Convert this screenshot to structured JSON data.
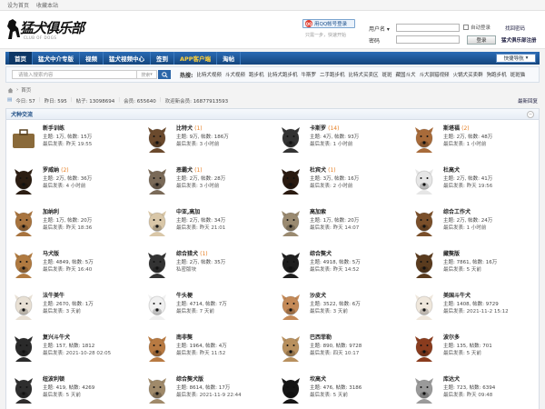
{
  "topbar": {
    "set_home": "设为首页",
    "bookmark": "收藏本站"
  },
  "logo": {
    "brand": "猛犬俱乐部",
    "sub": "CLUB OF DOGS"
  },
  "login": {
    "qq_label": "用QQ帐号登录",
    "qq_tip": "只需一步，快速开始",
    "username_label": "用户名",
    "password_label": "密码",
    "auto_login": "自动登录",
    "login_button": "登录",
    "forgot": "找回密码",
    "register": "猛犬俱乐部注册"
  },
  "nav": {
    "items": [
      "首页",
      "猛犬中介专版",
      "视频",
      "猛犬视频中心",
      "签到",
      "APP客户端",
      "淘帖"
    ],
    "quick_nav": "快捷导航"
  },
  "search": {
    "placeholder": "请输入搜索内容",
    "type": "搜索",
    "hot_label": "热搜:",
    "hot_links": [
      "比特犬视频",
      "斗犬视频",
      "跑步机",
      "比特犬跑步机",
      "牛斯罗",
      "二手跑步机",
      "比特犬买卖区",
      "斑斑",
      "藏国斗犬",
      "斗犬驯猎视频",
      "火锅犬买卖群",
      "狗跑步机",
      "斑斑猫"
    ]
  },
  "breadcrumb": {
    "home": "首页"
  },
  "stats": {
    "today_label": "今日:",
    "today": "57",
    "yesterday_label": "昨日:",
    "yesterday": "595",
    "posts_label": "帖子:",
    "posts": "13098694",
    "members_label": "会员:",
    "members": "655640",
    "newest_label": "欢迎新会员:",
    "newest": "16877913593",
    "latest_reply": "最新回复"
  },
  "forum": {
    "title": "犬种交流",
    "collapse": "−",
    "boards": [
      {
        "name": "新手训练",
        "new": "",
        "meta": "主题: 1万, 帖数: 15万",
        "last": "最后发表: 昨天 19:55",
        "icon": "briefcase-icon",
        "color": "#8a6a3a"
      },
      {
        "name": "比特犬",
        "new": "(1)",
        "meta": "主题: 9万, 帖数: 186万",
        "last": "最后发表: 3 小时前",
        "icon": "pitbull-icon",
        "color": "#6b4a2d"
      },
      {
        "name": "卡斯罗",
        "new": "(14)",
        "meta": "主题: 4万, 帖数: 93万",
        "last": "最后发表: 1 小时前",
        "icon": "cane-corso-icon",
        "color": "#333"
      },
      {
        "name": "斯塔福",
        "new": "(2)",
        "meta": "主题: 2万, 帖数: 48万",
        "last": "最后发表: 1 小时前",
        "icon": "staffy-icon",
        "color": "#a86b3a"
      },
      {
        "name": "罗威纳",
        "new": "(2)",
        "meta": "主题: 2万, 帖数: 36万",
        "last": "最后发表: 4 小时前",
        "icon": "rottweiler-icon",
        "color": "#2b1d12"
      },
      {
        "name": "恶霸犬",
        "new": "(1)",
        "meta": "主题: 2万, 帖数: 28万",
        "last": "最后发表: 3 小时前",
        "icon": "bully-icon",
        "color": "#7a6a58"
      },
      {
        "name": "杜宾犬",
        "new": "(1)",
        "meta": "主题: 3万, 帖数: 16万",
        "last": "最后发表: 2 小时前",
        "icon": "doberman-icon",
        "color": "#2a1a10"
      },
      {
        "name": "杜高犬",
        "new": "",
        "meta": "主题: 2万, 帖数: 41万",
        "last": "最后发表: 昨天 19:56",
        "icon": "dogo-icon",
        "color": "#e6e6e6"
      },
      {
        "name": "加纳利",
        "new": "",
        "meta": "主题: 1万, 帖数: 20万",
        "last": "最后发表: 昨天 18:36",
        "icon": "presa-icon",
        "color": "#a8743f"
      },
      {
        "name": "中亚,高加",
        "new": "",
        "meta": "主题: 2万, 帖数: 34万",
        "last": "最后发表: 昨天 21:01",
        "icon": "caucasian-icon",
        "color": "#d9c7a8"
      },
      {
        "name": "高加索",
        "new": "",
        "meta": "主题: 1万, 帖数: 20万",
        "last": "最后发表: 昨天 14:07",
        "icon": "kangal-icon",
        "color": "#9a8a70"
      },
      {
        "name": "综合工作犬",
        "new": "",
        "meta": "主题: 2万, 帖数: 24万",
        "last": "最后发表: 1 小时前",
        "icon": "shepherd-icon",
        "color": "#7a4f2a"
      },
      {
        "name": "马犬版",
        "new": "",
        "meta": "主题: 4849, 帖数: 5万",
        "last": "最后发表: 昨天 16:40",
        "icon": "malinois-icon",
        "color": "#b07a40"
      },
      {
        "name": "综合猎犬",
        "new": "(1)",
        "meta": "主题: 2万, 帖数: 35万",
        "last": "私密版块",
        "icon": "hound-icon",
        "color": "#333"
      },
      {
        "name": "综合獒犬",
        "new": "",
        "meta": "主题: 4918, 帖数: 5万",
        "last": "最后发表: 昨天 14:52",
        "icon": "mastiff-icon",
        "color": "#1e1e1e"
      },
      {
        "name": "藏獒版",
        "new": "",
        "meta": "主题: 7861, 帖数: 16万",
        "last": "最后发表: 5 天前",
        "icon": "tibetan-icon",
        "color": "#5a3b1e"
      },
      {
        "name": "法牛美牛",
        "new": "",
        "meta": "主题: 2670, 帖数: 1万",
        "last": "最后发表: 3 天前",
        "icon": "frenchie-icon",
        "color": "#e8e0d4"
      },
      {
        "name": "牛头梗",
        "new": "",
        "meta": "主题: 4714, 帖数: 7万",
        "last": "最后发表: 7 天前",
        "icon": "bull-terrier-icon",
        "color": "#f0f0f0"
      },
      {
        "name": "沙皮犬",
        "new": "",
        "meta": "主题: 3522, 帖数: 6万",
        "last": "最后发表: 3 天前",
        "icon": "sharpei-icon",
        "color": "#c48a58"
      },
      {
        "name": "美国斗牛犬",
        "new": "",
        "meta": "主题: 1408, 帖数: 9729",
        "last": "最后发表: 2021-11-2 15:12",
        "icon": "american-bulldog-icon",
        "color": "#efe7dc"
      },
      {
        "name": "复兴斗牛犬",
        "new": "",
        "meta": "主题: 157, 帖数: 1812",
        "last": "最后发表: 2021-10-28 02:05",
        "icon": "olde-bulldog-icon",
        "color": "#2a2a2a"
      },
      {
        "name": "南非獒",
        "new": "",
        "meta": "主题: 1964, 帖数: 4万",
        "last": "最后发表: 昨天 11:52",
        "icon": "boerboel-icon",
        "color": "#b87a42"
      },
      {
        "name": "巴西菲勒",
        "new": "",
        "meta": "主题: 890, 帖数: 9728",
        "last": "最后发表: 四天 10:17",
        "icon": "fila-icon",
        "color": "#b8905e"
      },
      {
        "name": "波尔多",
        "new": "",
        "meta": "主题: 135, 帖数: 701",
        "last": "最后发表: 5 天前",
        "icon": "bordeaux-icon",
        "color": "#8a3c1e"
      },
      {
        "name": "纽波利顿",
        "new": "",
        "meta": "主题: 419, 帖数: 4269",
        "last": "最后发表: 5 天前",
        "icon": "neapolitan-icon",
        "color": "#2e2e2e"
      },
      {
        "name": "综合獒犬版",
        "new": "",
        "meta": "主题: 8614, 帖数: 17万",
        "last": "最后发表: 2021-11-9 22:44",
        "icon": "mastiff-icon",
        "color": "#a08a6a"
      },
      {
        "name": "坎高犬",
        "new": "",
        "meta": "主题: 476, 帖数: 3186",
        "last": "最后发表: 5 天前",
        "icon": "kangal-icon",
        "color": "#151515"
      },
      {
        "name": "库达犬",
        "new": "",
        "meta": "主题: 723, 帖数: 6394",
        "last": "最后发表: 昨天 09:48",
        "icon": "kuchi-icon",
        "color": "#9a9a9a"
      }
    ]
  }
}
